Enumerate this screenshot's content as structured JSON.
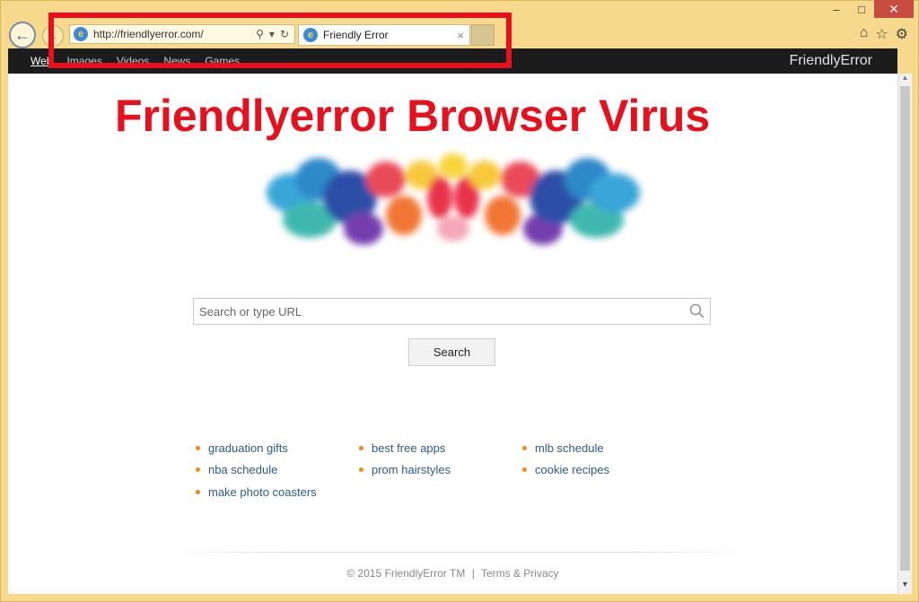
{
  "browser": {
    "address_url": "http://friendlyerror.com/",
    "tab_title": "Friendly Error",
    "tab_close": "×",
    "window_controls": {
      "minimize": "–",
      "maximize": "□",
      "close": "✕"
    },
    "icons": [
      "back-arrow-icon",
      "forward-arrow-icon",
      "ie-logo-icon",
      "search-icon",
      "dropdown-icon",
      "refresh-icon",
      "home-icon",
      "favorites-star-icon",
      "settings-gear-icon"
    ]
  },
  "topbar": {
    "links": [
      "Web",
      "Images",
      "Videos",
      "News",
      "Games"
    ],
    "brand": "FriendlyError"
  },
  "headline": "Friendlyerror Browser Virus",
  "search": {
    "placeholder": "Search or type URL",
    "button_label": "Search"
  },
  "suggestions": {
    "row1": [
      "graduation gifts",
      "best free apps",
      "mlb schedule"
    ],
    "row2": [
      "nba schedule",
      "prom hairstyles",
      "cookie recipes"
    ],
    "row3": [
      "make photo coasters"
    ]
  },
  "footer": {
    "copyright": "© 2015 FriendlyError TM",
    "separator": "|",
    "terms": "Terms & Privacy"
  },
  "colors": {
    "highlight_red": "#e8101c",
    "frame_gold": "#f6d98c",
    "link_blue": "#2a5a92",
    "bullet_orange": "#f08a14"
  }
}
